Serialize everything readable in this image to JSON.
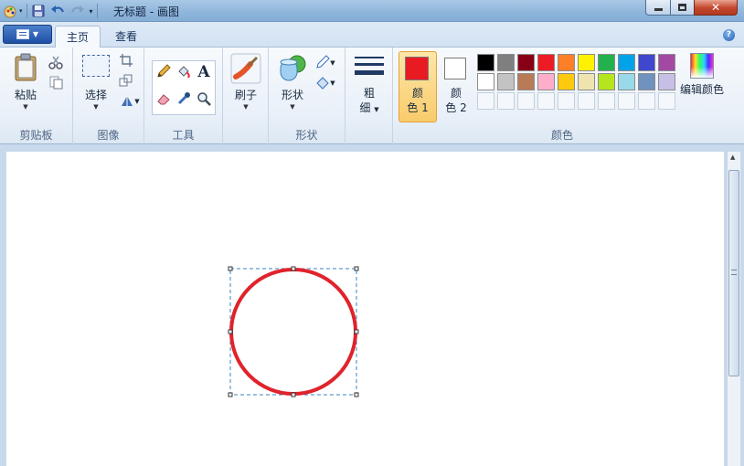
{
  "window": {
    "title": "无标题 - 画图"
  },
  "tabs": [
    {
      "label": "主页",
      "active": true
    },
    {
      "label": "查看",
      "active": false
    }
  ],
  "groups": {
    "clipboard": {
      "label": "剪贴板",
      "paste_top": "粘",
      "paste_label": "粘贴"
    },
    "image": {
      "label": "图像",
      "select_label": "选择"
    },
    "tools": {
      "label": "工具"
    },
    "brushes": {
      "label": "刷子"
    },
    "shapes": {
      "label": "形状",
      "shapes_label": "形状"
    },
    "size": {
      "label_top": "粗",
      "label_bottom": "细"
    },
    "colors": {
      "label": "颜色",
      "color1_top": "颜",
      "color1_bottom": "色 1",
      "color2_top": "颜",
      "color2_bottom": "色 2",
      "edit_label": "编辑颜色",
      "color1_value": "#e81b23",
      "color2_value": "#ffffff",
      "palette_row1": [
        "#000000",
        "#7f7f7f",
        "#880015",
        "#ed1c24",
        "#ff7f27",
        "#fff200",
        "#22b14c",
        "#00a2e8",
        "#3f48cc",
        "#a349a4"
      ],
      "palette_row2": [
        "#ffffff",
        "#c3c3c3",
        "#b97a57",
        "#ffaec9",
        "#ffc90e",
        "#efe4b0",
        "#b5e61d",
        "#99d9ea",
        "#7092be",
        "#c8bfe7"
      ]
    }
  },
  "canvas": {
    "shape": "ellipse",
    "stroke_color": "#e0232b"
  }
}
